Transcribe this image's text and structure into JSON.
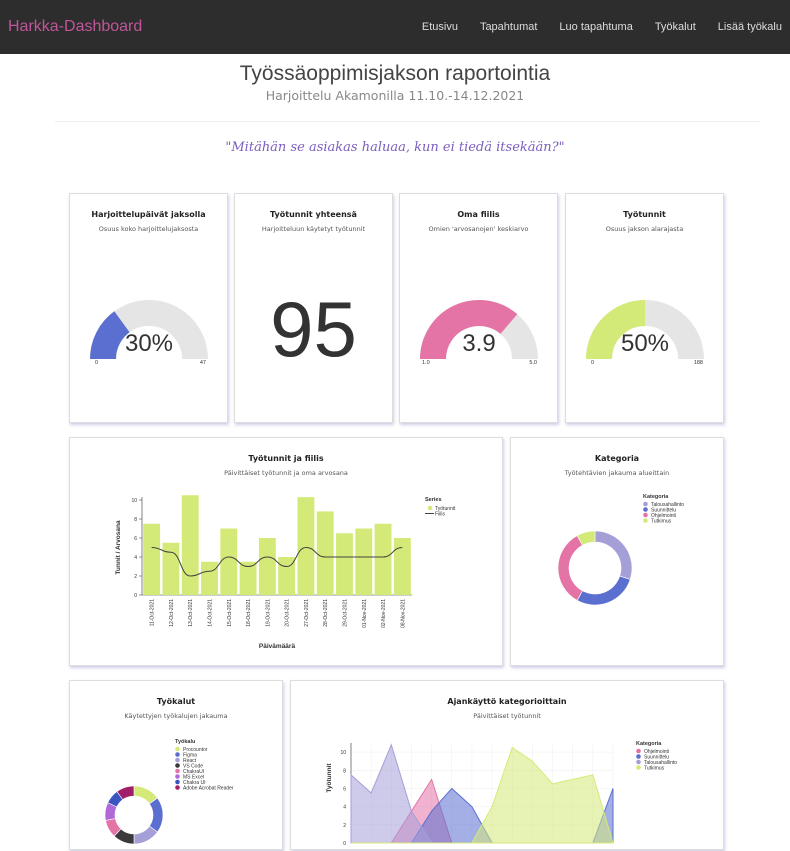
{
  "navbar": {
    "brand": "Harkka-Dashboard",
    "items": [
      "Etusivu",
      "Tapahtumat",
      "Luo tapahtuma",
      "Työkalut",
      "Lisää työkalu"
    ]
  },
  "header": {
    "title": "Työssäoppimisjakson raportointia",
    "subtitle": "Harjoittelu Akamonilla 11.10.-14.12.2021",
    "quote": "\"Mitähän se asiakas haluaa, kun ei tiedä itsekään?\""
  },
  "cards": {
    "days": {
      "title": "Harjoittelupäivät jaksolla",
      "subtitle": "Osuus koko harjoittelujaksosta",
      "value": "30%",
      "min": "0",
      "max": "47",
      "fraction": 0.3,
      "color": "#5a6fd0"
    },
    "hours": {
      "title": "Työtunnit yhteensä",
      "subtitle": "Harjoitteluun käytetyt työtunnit",
      "value": "95"
    },
    "mood": {
      "title": "Oma fiilis",
      "subtitle": "Omien 'arvosanojen' keskiarvo",
      "value": "3.9",
      "min": "1.0",
      "max": "5.0",
      "fraction": 0.725,
      "color": "#e473a6"
    },
    "hourspct": {
      "title": "Työtunnit",
      "subtitle": "Osuus jakson alarajasta",
      "value": "50%",
      "min": "0",
      "max": "188",
      "fraction": 0.5,
      "color": "#d4ea78"
    }
  },
  "chart_data": [
    {
      "type": "bar",
      "title": "Työtunnit ja fiilis",
      "subtitle": "Päivittäiset työtunnit ja oma arvosana",
      "xlabel": "Päivämäärä",
      "ylabel": "Tunnit / Arvosana",
      "ylim": [
        0,
        10
      ],
      "yticks": [
        "0",
        "2",
        "4",
        "6",
        "8",
        "10"
      ],
      "legend_title": "Series",
      "categories": [
        "11-Oct-2021",
        "12-Oct-2021",
        "13-Oct-2021",
        "14-Oct-2021",
        "15-Oct-2021",
        "18-Oct-2021",
        "19-Oct-2021",
        "20-Oct-2021",
        "27-Oct-2021",
        "28-Oct-2021",
        "29-Oct-2021",
        "01-Nov-2021",
        "02-Nov-2021",
        "08-Nov-2021"
      ],
      "series": [
        {
          "name": "Työtunnit",
          "type": "bar",
          "color": "#d4ea78",
          "values": [
            7.5,
            5.5,
            10.5,
            3.5,
            7,
            3.5,
            6,
            4,
            10.3,
            8.8,
            6.5,
            7,
            7.5,
            6
          ]
        },
        {
          "name": "Fiilis",
          "type": "line",
          "color": "#444444",
          "values": [
            5,
            4.5,
            2,
            2.5,
            4,
            3,
            4,
            3,
            5,
            4,
            4,
            4,
            4,
            5
          ]
        }
      ]
    },
    {
      "type": "pie",
      "title": "Kategoria",
      "subtitle": "Työtehtävien jakauma alueittain",
      "legend_title": "Kategoria",
      "labels": [
        "Talousahallinto",
        "Suunnittelu",
        "Ohjelmointi",
        "Tutkimus"
      ],
      "values": [
        30,
        28,
        34,
        8
      ],
      "colors": [
        "#a59fd8",
        "#5a6fd0",
        "#e473a6",
        "#d4ea78"
      ]
    },
    {
      "type": "pie",
      "title": "Työkalut",
      "subtitle": "Käytettyjen työkalujen jakauma",
      "legend_title": "Työkalu",
      "labels": [
        "Procountor",
        "Figma",
        "React",
        "VS Code",
        "ChakraUI",
        "MS Excel",
        "Chakra UI",
        "Adobe Acrobat Reader"
      ],
      "values": [
        15,
        20,
        15,
        12,
        10,
        10,
        8,
        10
      ],
      "colors": [
        "#d4ea78",
        "#5a6fd0",
        "#a59fd8",
        "#3a3a3a",
        "#e473a6",
        "#b06ad8",
        "#3b55c0",
        "#a01e6a"
      ]
    },
    {
      "type": "area",
      "title": "Ajankäyttö kategorioittain",
      "subtitle": "Päivittäiset työtunnit",
      "ylabel": "Työtunnit",
      "ylim": [
        0,
        11
      ],
      "yticks": [
        "0",
        "2",
        "4",
        "6",
        "8",
        "10"
      ],
      "legend_title": "Kategoria",
      "x": [
        0,
        1,
        2,
        3,
        4,
        5,
        6,
        7,
        8,
        9,
        10,
        11,
        12,
        13
      ],
      "series": [
        {
          "name": "Ohjelmointi",
          "color": "#e473a6",
          "values": [
            0,
            0,
            0,
            3.5,
            7,
            0,
            0,
            0,
            0,
            0,
            0,
            0,
            0,
            0
          ]
        },
        {
          "name": "Suunnittelu",
          "color": "#5a6fd0",
          "values": [
            0,
            0,
            0,
            0,
            3.5,
            6,
            4,
            0,
            0,
            0,
            0,
            0,
            0,
            6
          ]
        },
        {
          "name": "Talousahallinto",
          "color": "#a59fd8",
          "values": [
            7.5,
            5.5,
            10.8,
            3.5,
            0,
            0,
            0,
            0,
            0,
            0,
            0,
            0,
            0,
            0
          ]
        },
        {
          "name": "Tutkimus",
          "color": "#d4ea78",
          "values": [
            0,
            0,
            0,
            0,
            0,
            0,
            0,
            4,
            10.5,
            9,
            6.5,
            7,
            7.5,
            0
          ]
        }
      ]
    }
  ]
}
